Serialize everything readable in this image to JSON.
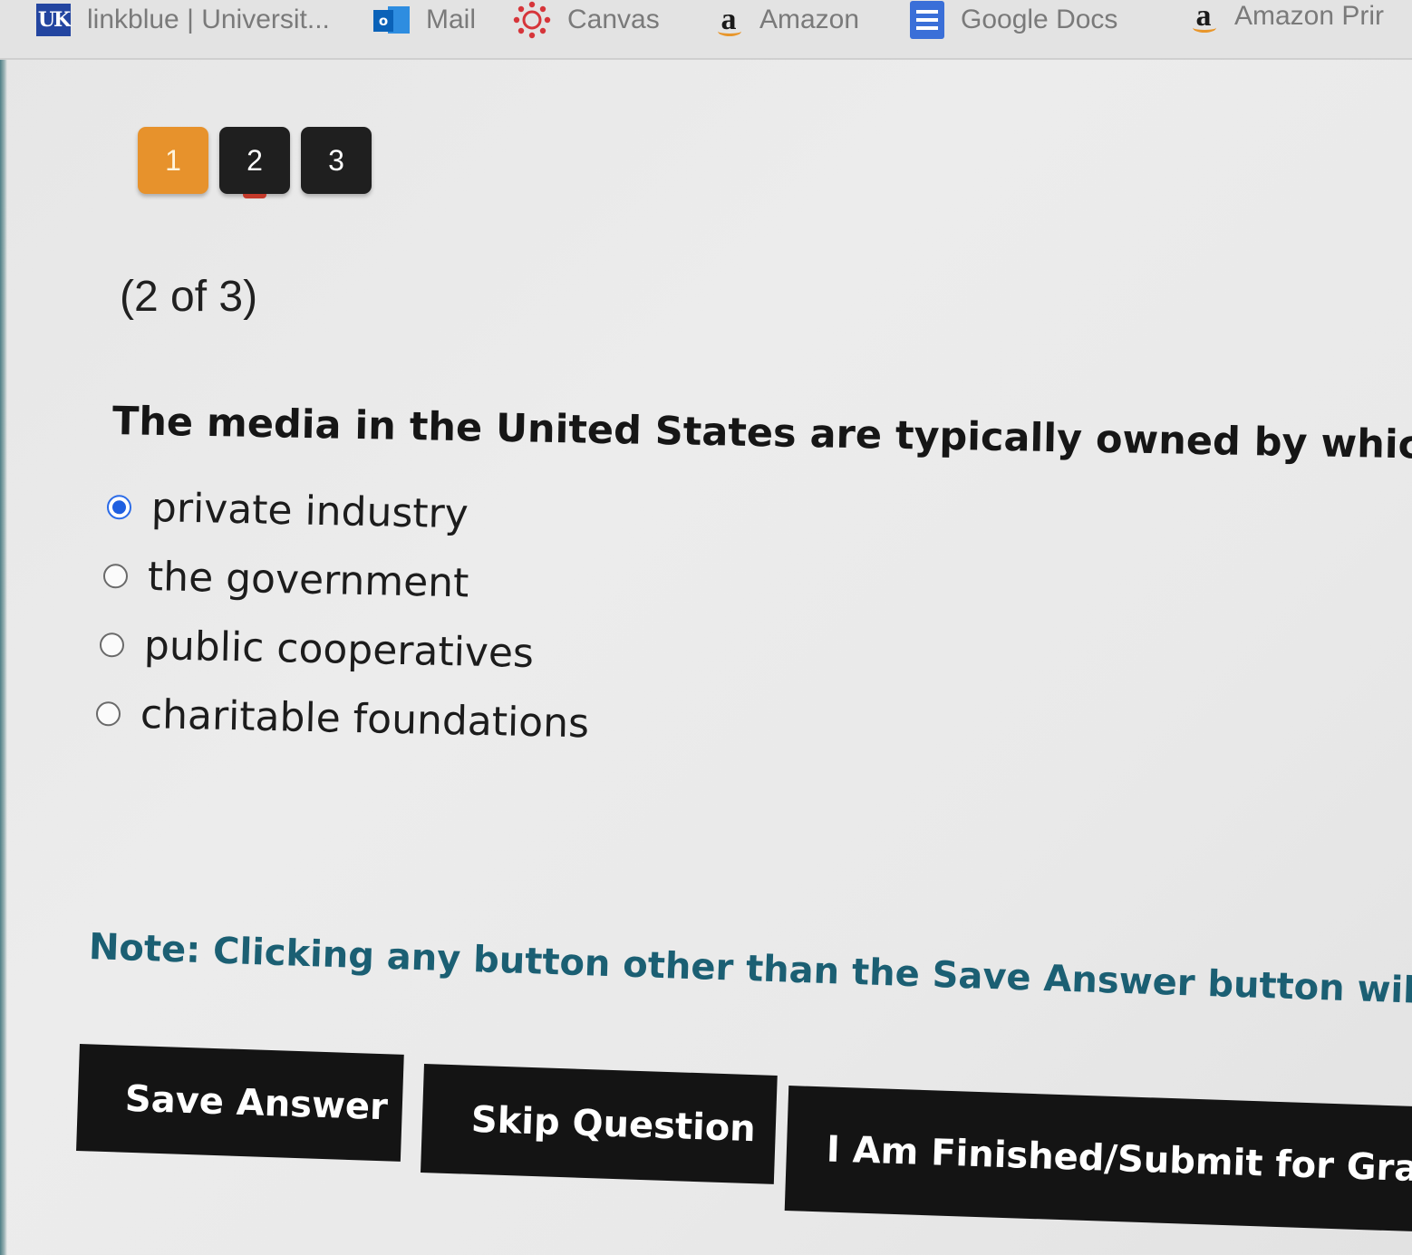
{
  "bookmarks": [
    {
      "label": "linkblue | Universit...",
      "icon": "uk-logo-icon"
    },
    {
      "label": "Mail",
      "icon": "outlook-icon"
    },
    {
      "label": "Canvas",
      "icon": "canvas-icon"
    },
    {
      "label": "Amazon",
      "icon": "amazon-icon"
    },
    {
      "label": "Google Docs",
      "icon": "google-docs-icon"
    },
    {
      "label": "Amazon Prir",
      "icon": "amazon-icon"
    }
  ],
  "question_nav": {
    "items": [
      "1",
      "2",
      "3"
    ],
    "current": "2",
    "colors": {
      "answered": "#e7922c",
      "default": "#1f1f1f",
      "current_marker": "#c43a2b"
    }
  },
  "progress": "(2 of 3)",
  "question": {
    "text": "The media in the United States are typically owned by which"
  },
  "options": [
    {
      "label": "private industry",
      "selected": true
    },
    {
      "label": "the government",
      "selected": false
    },
    {
      "label": "public cooperatives",
      "selected": false
    },
    {
      "label": "charitable foundations",
      "selected": false
    }
  ],
  "note": "Note: Clicking any button other than the Save Answer button will NOT",
  "buttons": {
    "save": "Save Answer",
    "skip": "Skip Question",
    "finish": "I Am Finished/Submit for Grac"
  },
  "colors": {
    "note_text": "#1b5f73",
    "button_bg": "#141414",
    "radio_selected": "#1f5fe0"
  }
}
